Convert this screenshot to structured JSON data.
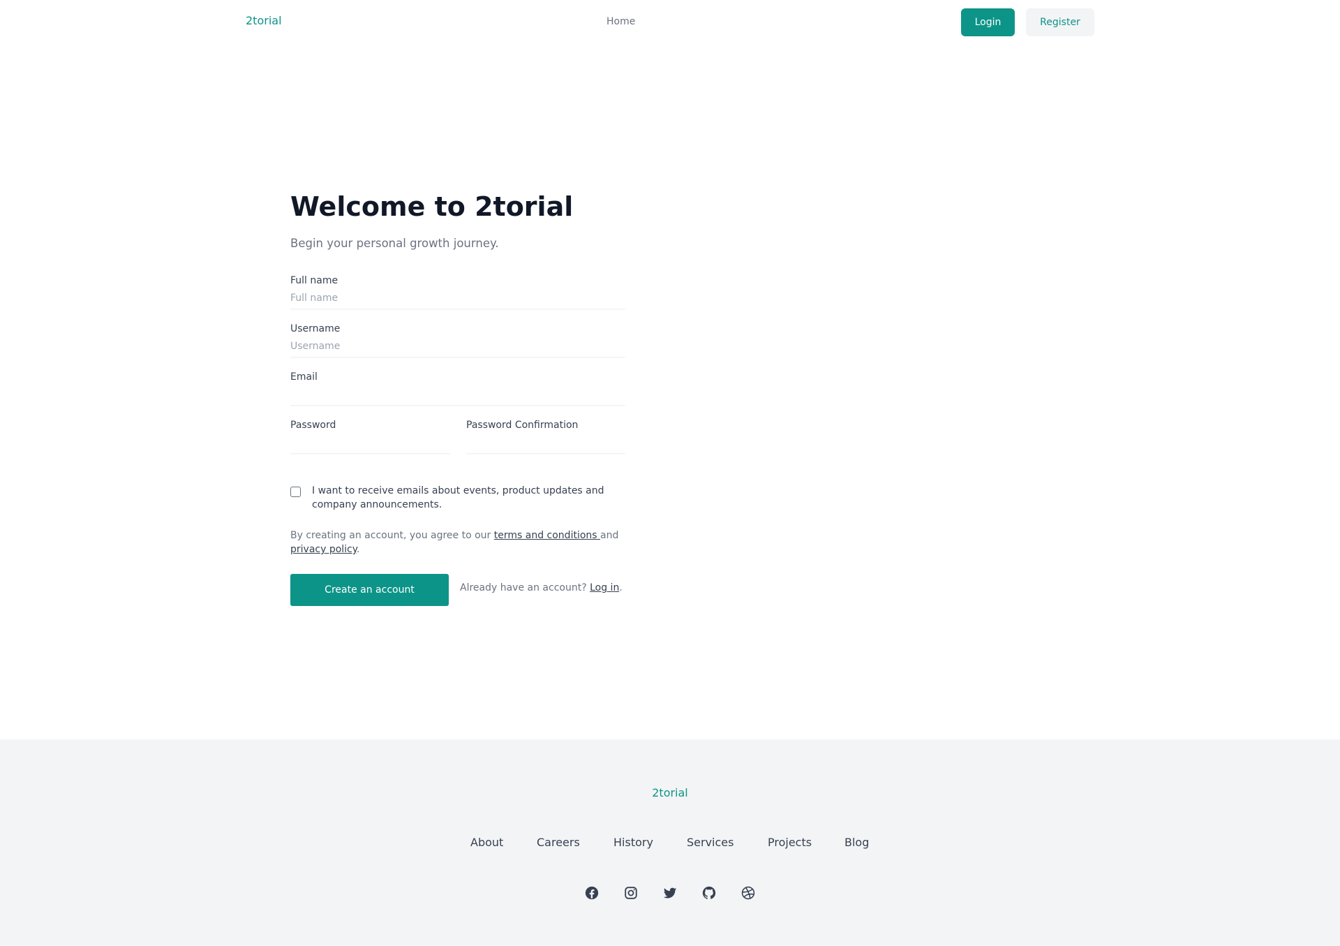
{
  "header": {
    "brand": "2torial",
    "nav_home": "Home",
    "login_label": "Login",
    "register_label": "Register"
  },
  "form": {
    "title": "Welcome to 2torial",
    "subtitle": "Begin your personal growth journey.",
    "full_name": {
      "label": "Full name",
      "placeholder": "Full name",
      "value": ""
    },
    "username": {
      "label": "Username",
      "placeholder": "Username",
      "value": ""
    },
    "email": {
      "label": "Email",
      "placeholder": "",
      "value": ""
    },
    "password": {
      "label": "Password",
      "value": ""
    },
    "password_confirmation": {
      "label": "Password Confirmation",
      "value": ""
    },
    "newsletter": {
      "checked": false,
      "label": "I want to receive emails about events, product updates and company announcements."
    },
    "terms": {
      "prefix": "By creating an account, you agree to our ",
      "terms_link": "terms and conditions ",
      "middle": "and",
      "privacy_link": "privacy policy",
      "suffix": "."
    },
    "create_button": "Create an account",
    "already": {
      "prefix": "Already have an account? ",
      "login_link": "Log in",
      "suffix": "."
    }
  },
  "footer": {
    "brand": "2torial",
    "links": [
      "About",
      "Careers",
      "History",
      "Services",
      "Projects",
      "Blog"
    ],
    "social_icons": [
      "facebook-icon",
      "instagram-icon",
      "twitter-icon",
      "github-icon",
      "dribbble-icon"
    ]
  },
  "colors": {
    "accent": "#0d9488",
    "heading": "#111827",
    "muted": "#6b7280",
    "footer_bg": "#f3f4f6"
  }
}
